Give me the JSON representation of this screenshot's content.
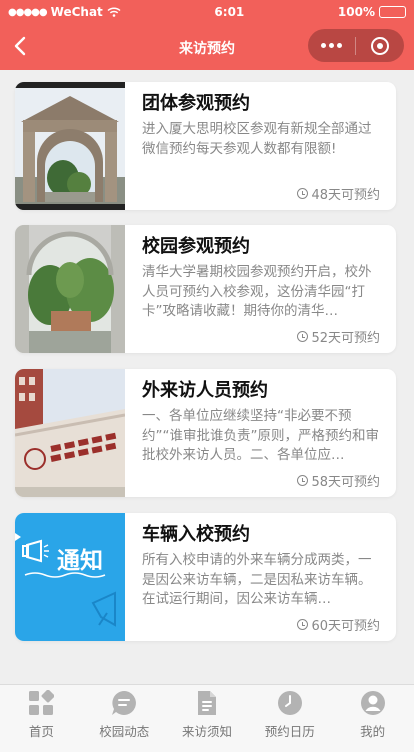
{
  "status_bar": {
    "carrier": "WeChat",
    "time": "6:01",
    "battery": "100%"
  },
  "nav": {
    "title": "来访预约"
  },
  "cards": [
    {
      "title": "团体参观预约",
      "desc": "进入厦大思明校区参观有新规全部通过微信预约每天参观人数都有限额!",
      "avail": "48天可预约",
      "image_icon": "campus-gate-image"
    },
    {
      "title": "校园参观预约",
      "desc": "清华大学暑期校园参观预约开启，校外人员可预约入校参观，这份清华园“打卡”攻略请收藏！期待你的清华…",
      "avail": "52天可预约",
      "image_icon": "campus-arch-image"
    },
    {
      "title": "外来访人员预约",
      "desc": "一、各单位应继续坚持“非必要不预约”“谁审批谁负责”原则，严格预约和审批校外来访人员。二、各单位应…",
      "avail": "58天可预约",
      "image_icon": "university-sign-image"
    },
    {
      "title": "车辆入校预约",
      "desc": "所有入校申请的外来车辆分成两类，一是因公来访车辆，二是因私来访车辆。在试运行期间，因公来访车辆…",
      "avail": "60天可预约",
      "image_icon": "notice-banner-image",
      "banner_text": "通知"
    }
  ],
  "tabbar": [
    {
      "label": "首页",
      "icon": "home-grid-icon"
    },
    {
      "label": "校园动态",
      "icon": "chat-bubble-icon"
    },
    {
      "label": "来访须知",
      "icon": "document-icon"
    },
    {
      "label": "预约日历",
      "icon": "clock-icon"
    },
    {
      "label": "我的",
      "icon": "user-icon"
    }
  ],
  "colors": {
    "brand": "#f2605a",
    "capsule": "#b94743",
    "background": "#efefef",
    "muted": "#888888",
    "tab_icon": "#b3b3b3"
  }
}
